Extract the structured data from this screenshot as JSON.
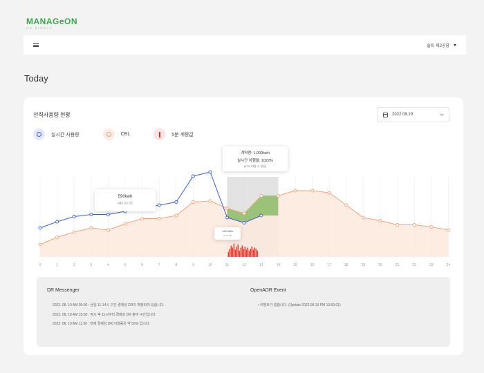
{
  "brand": {
    "logo_prefix": "MANAG",
    "logo_o": "e",
    "logo_suffix": "ON",
    "logo_sub": "ON SIMPLE"
  },
  "header": {
    "user": "솔트 제2공장"
  },
  "page": {
    "title": "Today"
  },
  "card": {
    "title": "전력사용량 현황",
    "date": "2022.08.19"
  },
  "legend": [
    {
      "label": "실시간 사용량",
      "color": "#3b5bdb",
      "bg": "#e3e8fb"
    },
    {
      "label": "CBL",
      "color": "#f4a07c",
      "bg": "#fdece3"
    },
    {
      "label": "5분 계량값",
      "color": "#d93025",
      "bg": "#fbe3e3"
    }
  ],
  "colors": {
    "realtime": "#3b5bdb",
    "cbl": "#f0a37e",
    "cbl_fill": "#fde9dc",
    "meter": "#d93025",
    "dr_window": "#d9d9d9",
    "reduction": "#8fbf6e"
  },
  "tooltips": {
    "main": {
      "line1": "계약량: 1,000kwh",
      "line2": "실시간 이행율: 1022%",
      "line3": "(97% 이상 시 성공)"
    },
    "point": {
      "line1": "590kwh",
      "line2": "AM 09:30"
    },
    "current": {
      "line1": "120 kWh",
      "line2": "10:00 PM"
    }
  },
  "chart_data": {
    "type": "line",
    "x": [
      "0",
      "1",
      "2",
      "3",
      "4",
      "5",
      "6",
      "7",
      "8",
      "9",
      "10",
      "11",
      "12",
      "13",
      "14",
      "15",
      "16",
      "17",
      "18",
      "19",
      "20",
      "21",
      "22",
      "23",
      "24"
    ],
    "ylim": [
      0,
      100
    ],
    "dr_window": [
      11,
      14
    ],
    "series": [
      {
        "name": "실시간 사용량",
        "x": [
          0,
          1,
          2,
          3,
          4,
          5,
          6,
          7,
          8,
          9,
          10,
          11,
          12,
          13
        ],
        "values": [
          28,
          34,
          39,
          41,
          41,
          44,
          47,
          50,
          53,
          78,
          82,
          38,
          33,
          40
        ]
      },
      {
        "name": "CBL",
        "x": [
          0,
          1,
          2,
          3,
          4,
          5,
          6,
          7,
          8,
          9,
          10,
          11,
          12,
          13,
          14,
          15,
          16,
          17,
          18,
          19,
          20,
          21,
          22,
          23,
          24
        ],
        "values": [
          12,
          19,
          24,
          28,
          26,
          32,
          37,
          37,
          40,
          53,
          54,
          47,
          42,
          59,
          59,
          64,
          64,
          62,
          50,
          38,
          35,
          31,
          31,
          29,
          26
        ]
      }
    ]
  },
  "dr_messenger": {
    "title": "DR Messenger",
    "messages": [
      "2022. 08. 19 AM 00:00 : 금일 11-14시 구간 경제성 DR이 예정되어 있습니다.",
      "2022. 08. 19 AM 10:50 : 잠시 후 11시부터 경제성 DR 참여 구간입니다.",
      "2022. 08. 19 AM 11:30 : 현재 경제성 DR 이행률은 약 56% 입니다."
    ]
  },
  "openadr": {
    "title": "OpenADR Event",
    "events": [
      "• 이벤트가 없습니다. (Update 2022.08.19 PM 13:00:01)"
    ]
  }
}
